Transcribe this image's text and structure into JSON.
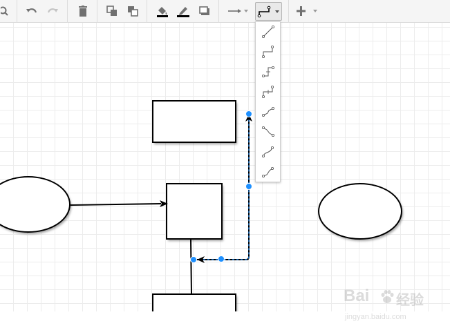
{
  "toolbar": {
    "buttons": [
      {
        "name": "zoom-out-button",
        "icon": "magnifier-icon"
      },
      {
        "name": "undo-button",
        "icon": "undo-icon"
      },
      {
        "name": "redo-button",
        "icon": "redo-icon"
      },
      {
        "name": "delete-button",
        "icon": "trash-icon"
      },
      {
        "name": "to-front-button",
        "icon": "to-front-icon"
      },
      {
        "name": "to-back-button",
        "icon": "to-back-icon"
      },
      {
        "name": "fill-color-button",
        "icon": "paint-bucket-icon"
      },
      {
        "name": "line-color-button",
        "icon": "pencil-icon"
      },
      {
        "name": "shadow-button",
        "icon": "shadow-icon"
      },
      {
        "name": "connection-style-button",
        "icon": "arrow-right-icon"
      },
      {
        "name": "waypoints-button",
        "icon": "orthogonal-edge-icon",
        "active": true
      },
      {
        "name": "insert-button",
        "icon": "plus-icon"
      }
    ]
  },
  "waypoint_menu": {
    "items": [
      {
        "name": "straight",
        "icon": "straight-edge-icon"
      },
      {
        "name": "orthogonal",
        "icon": "orthogonal-edge-icon"
      },
      {
        "name": "horizontal-elbow",
        "icon": "horizontal-elbow-icon"
      },
      {
        "name": "vertical-elbow",
        "icon": "vertical-elbow-icon"
      },
      {
        "name": "isometric-horizontal",
        "icon": "isometric-horizontal-icon"
      },
      {
        "name": "isometric-vertical",
        "icon": "isometric-vertical-icon"
      },
      {
        "name": "curved",
        "icon": "curved-edge-icon"
      },
      {
        "name": "entity-relation",
        "icon": "entity-relation-icon"
      }
    ]
  },
  "colors": {
    "toolbar_bg": "#f5f5f5",
    "icon": "#707070",
    "selection": "#1e90ff",
    "shape_stroke": "#000000",
    "grid": "#ececec"
  },
  "watermark": {
    "line1": "Bai",
    "line1b": "经验",
    "line2": "jingyan.baidu.com"
  }
}
